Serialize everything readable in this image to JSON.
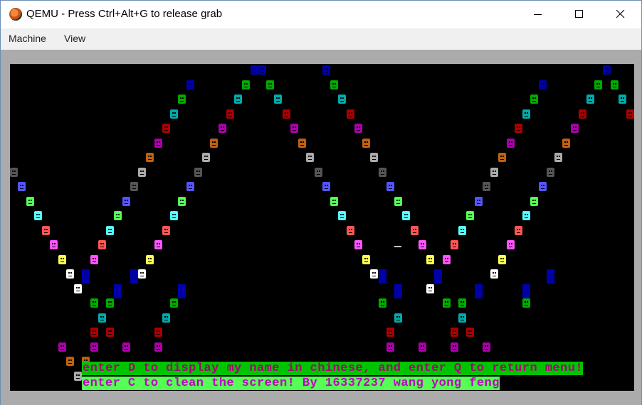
{
  "window": {
    "title": "QEMU - Press Ctrl+Alt+G to release grab",
    "icon": "qemu-icon"
  },
  "menu": {
    "items": [
      "Machine",
      "View"
    ]
  },
  "screen": {
    "line1": "enter D to display my name in chinese, and enter Q to return menu!",
    "line2": "enter C to clean the screen! By 16337237 wang yong feng",
    "palette": {
      "blue": "#0000aa",
      "green": "#00aa00",
      "cyan": "#00aaaa",
      "red": "#aa0000",
      "magenta": "#aa00aa",
      "brown": "#c06010",
      "lightgray": "#aaaaaa",
      "darkgray": "#555555",
      "lightblue": "#5555ff",
      "lightgreen": "#55ff55",
      "lightcyan": "#55ffff",
      "lightred": "#ff5555",
      "lightmagenta": "#ff55ff",
      "yellow": "#ffff55",
      "white": "#ffffff"
    }
  }
}
